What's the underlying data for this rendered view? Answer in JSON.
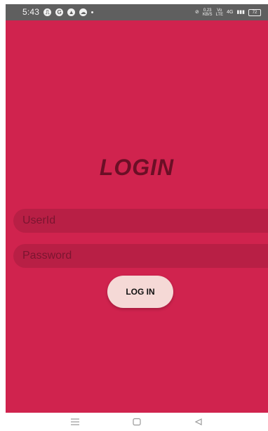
{
  "status_bar": {
    "time": "5:43",
    "left_icons": [
      "usb-icon",
      "google-icon",
      "maps-icon",
      "cloud-icon",
      "dot-icon"
    ],
    "network_speed_value": "0.23",
    "network_speed_unit": "KB/S",
    "volte_label": "Vo",
    "lte_label": "LTE",
    "network_type": "4G",
    "battery_level": "72"
  },
  "login_screen": {
    "title": "LOGIN",
    "userid_placeholder": "UserId",
    "password_placeholder": "Password",
    "login_button_label": "LOG IN",
    "background_color": "#d0234e",
    "field_color": "#b81f45",
    "button_color": "#f5d9d6"
  },
  "navigation_bar": {
    "items": [
      "menu-icon",
      "home-icon",
      "back-icon"
    ]
  }
}
